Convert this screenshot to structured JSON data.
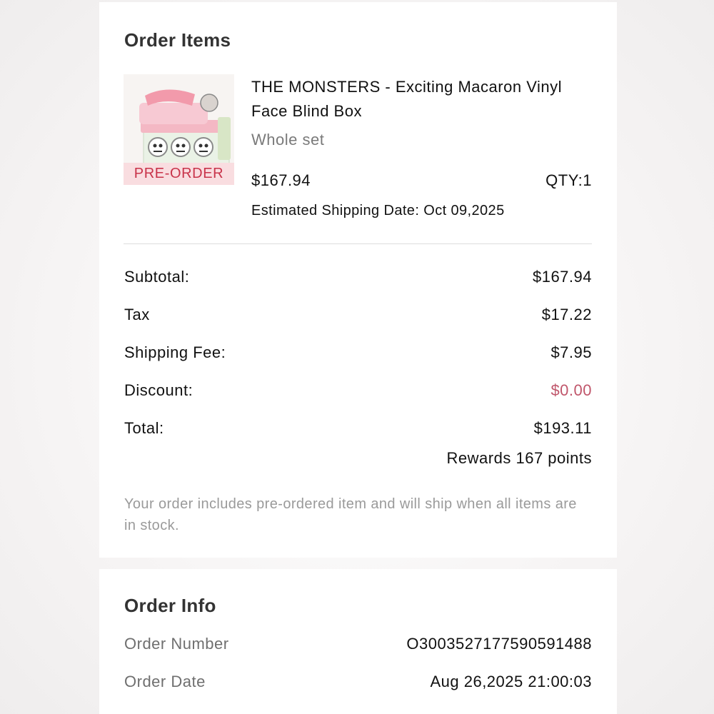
{
  "order_items": {
    "title": "Order Items",
    "item": {
      "name": "THE MONSTERS - Exciting Macaron Vinyl Face Blind Box",
      "variant": "Whole set",
      "price": "$167.94",
      "qty": "QTY:1",
      "shipping_date": "Estimated Shipping Date: Oct 09,2025",
      "tag": "PRE-ORDER",
      "tag_color": "#c8334a"
    },
    "summary": [
      {
        "label": "Subtotal:",
        "value": "$167.94"
      },
      {
        "label": "Tax",
        "value": "$17.22"
      },
      {
        "label": "Shipping Fee:",
        "value": "$7.95"
      },
      {
        "label": "Discount:",
        "value": "$0.00"
      },
      {
        "label": "Total:",
        "value": "$193.11"
      }
    ],
    "rewards": "Rewards 167 points",
    "note": "Your order includes pre-ordered item and will ship when all items are in stock."
  },
  "order_info": {
    "title": "Order Info",
    "rows": [
      {
        "label": "Order Number",
        "value": "O3003527177590591488"
      },
      {
        "label": "Order Date",
        "value": "Aug 26,2025 21:00:03"
      }
    ]
  },
  "colors": {
    "discount": "#c0566b",
    "page_background": "#f3f2f2"
  }
}
